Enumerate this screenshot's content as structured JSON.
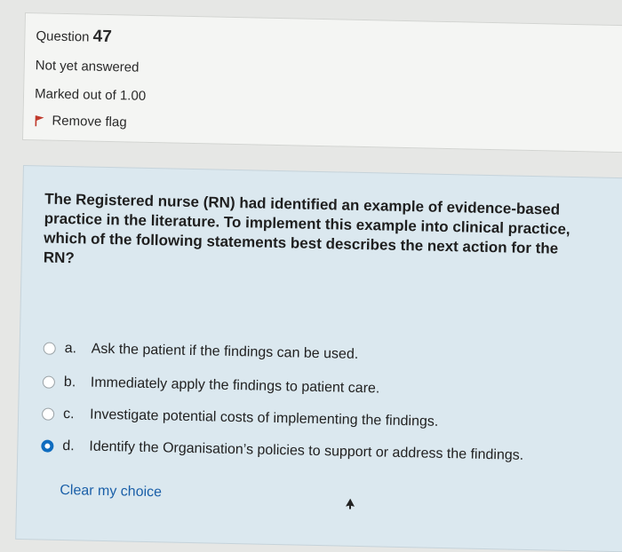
{
  "info": {
    "question_label": "Question",
    "question_number": "47",
    "status": "Not yet answered",
    "marked": "Marked out of 1.00",
    "flag_label": "Remove flag",
    "flag_color": "#c0392b"
  },
  "question": {
    "text": "The Registered nurse (RN) had identified an example of evidence-based practice in the literature. To implement this example into clinical practice, which of the following statements best describes the next action for the RN?",
    "options": [
      {
        "letter": "a.",
        "text": "Ask the patient if the findings can be used.",
        "selected": false
      },
      {
        "letter": "b.",
        "text": "Immediately apply the findings to patient care.",
        "selected": false
      },
      {
        "letter": "c.",
        "text": "Investigate potential costs of implementing the findings.",
        "selected": false
      },
      {
        "letter": "d.",
        "text": "Identify the Organisation’s policies to support or address the findings.",
        "selected": true
      }
    ],
    "clear_label": "Clear my choice"
  },
  "colors": {
    "accent": "#0f6cbf",
    "panel_bg": "#dbe8ef"
  }
}
